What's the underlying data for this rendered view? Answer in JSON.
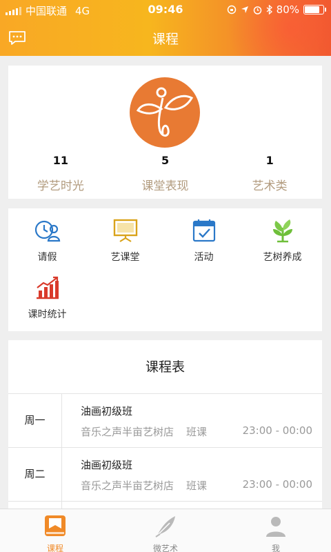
{
  "status_bar": {
    "carrier": "中国联通",
    "network": "4G",
    "time": "09:46",
    "battery": "80%",
    "battery_level": 0.8
  },
  "header": {
    "title": "课程"
  },
  "profile": {
    "stats": [
      {
        "value": "11",
        "label": "学艺时光"
      },
      {
        "value": "5",
        "label": "课堂表现"
      },
      {
        "value": "1",
        "label": "艺术类"
      }
    ]
  },
  "menu": {
    "items": [
      {
        "label": "请假",
        "icon": "leave-icon"
      },
      {
        "label": "艺课堂",
        "icon": "classroom-icon"
      },
      {
        "label": "活动",
        "icon": "calendar-icon"
      },
      {
        "label": "艺树养成",
        "icon": "tree-icon"
      },
      {
        "label": "课时统计",
        "icon": "chart-icon"
      }
    ]
  },
  "schedule": {
    "title": "课程表",
    "rows": [
      {
        "day": "周一",
        "course": "油画初级班",
        "venue": "音乐之声半亩艺树店",
        "type": "班课",
        "time": "23:00 - 00:00"
      },
      {
        "day": "周二",
        "course": "油画初级班",
        "venue": "音乐之声半亩艺树店",
        "type": "班课",
        "time": "23:00 - 00:00"
      }
    ]
  },
  "tabbar": {
    "tabs": [
      {
        "label": "课程",
        "active": true
      },
      {
        "label": "微艺术",
        "active": false
      },
      {
        "label": "我",
        "active": false
      }
    ]
  },
  "colors": {
    "accent": "#f08a28",
    "header_start": "#f9a825",
    "header_end": "#ef5a2e",
    "stat_label": "#b29b7e"
  }
}
